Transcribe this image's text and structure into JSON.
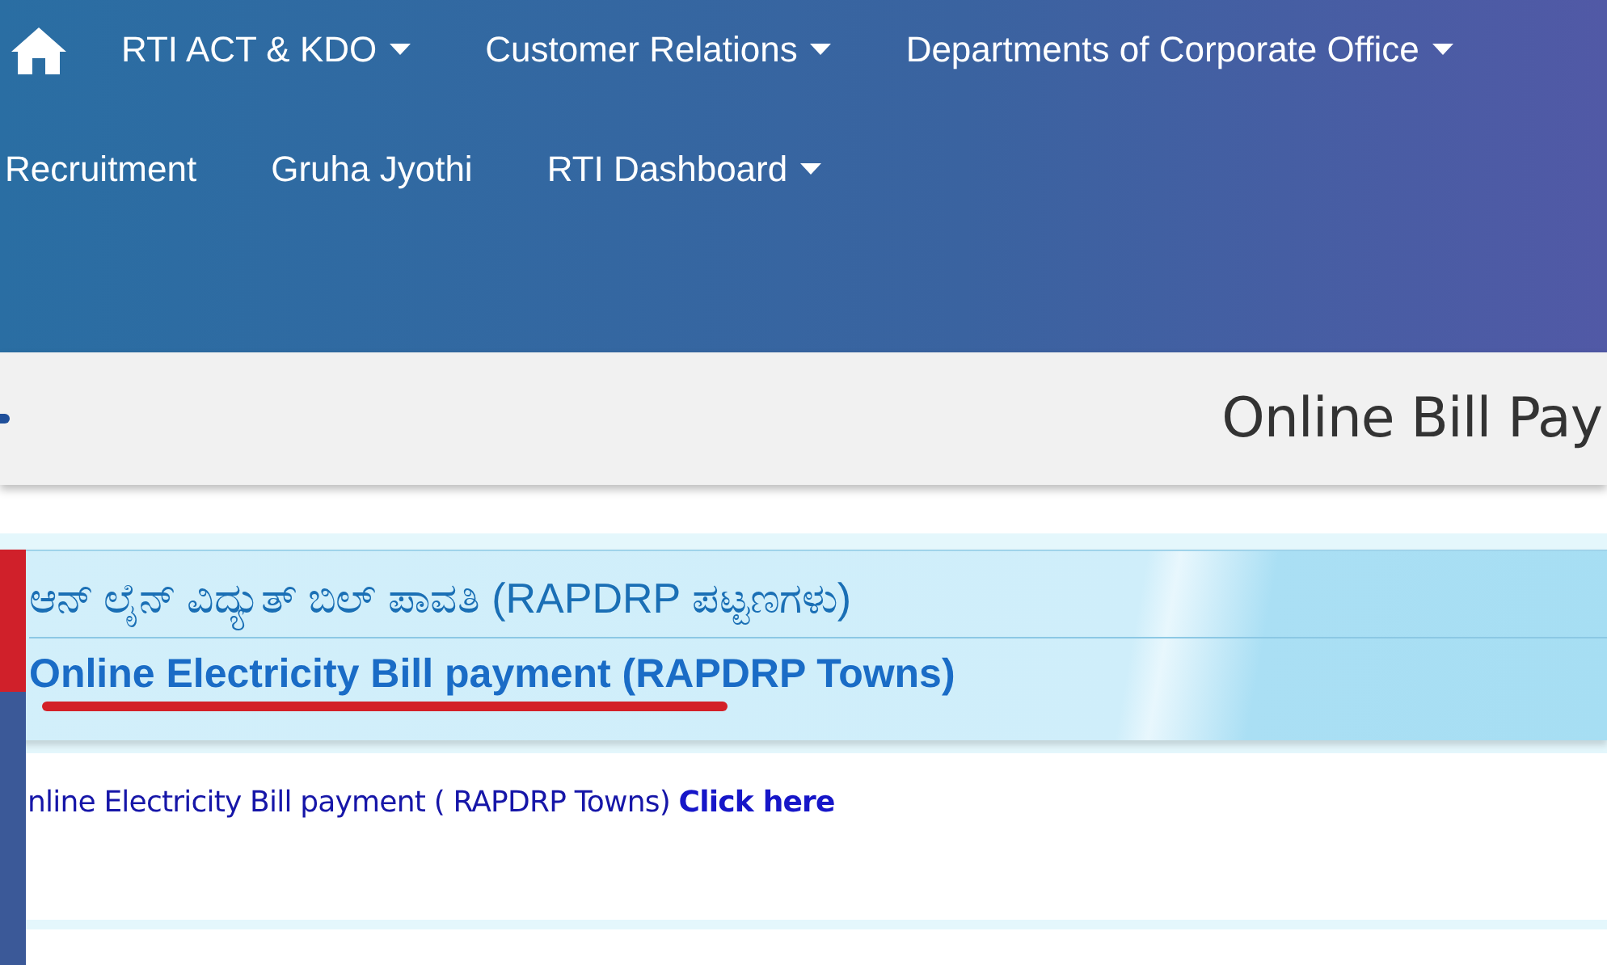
{
  "nav": {
    "primary_items": [
      {
        "label": "RTI ACT & KDO",
        "dropdown": true
      },
      {
        "label": "Customer Relations",
        "dropdown": true
      },
      {
        "label": "Departments of Corporate Office",
        "dropdown": true
      }
    ],
    "secondary_items": [
      {
        "label": "Recruitment",
        "dropdown": false
      },
      {
        "label": "Gruha Jyothi",
        "dropdown": false
      },
      {
        "label": "RTI Dashboard",
        "dropdown": true
      }
    ]
  },
  "page_title": "Online Bill Pay",
  "banner": {
    "title_kannada": "ಆನ್ ಲೈನ್ ವಿದ್ಯುತ್ ಬಿಲ್ ಪಾವತಿ (RAPDRP ಪಟ್ಟಣಗಳು)",
    "title_english": "Online Electricity Bill payment (RAPDRP Towns)"
  },
  "body": {
    "text": "nline Electricity Bill payment ( RAPDRP Towns)",
    "link": "Click here"
  },
  "side_tabs": [
    {
      "color": "#d0202a"
    },
    {
      "color": "#3b5998"
    }
  ]
}
